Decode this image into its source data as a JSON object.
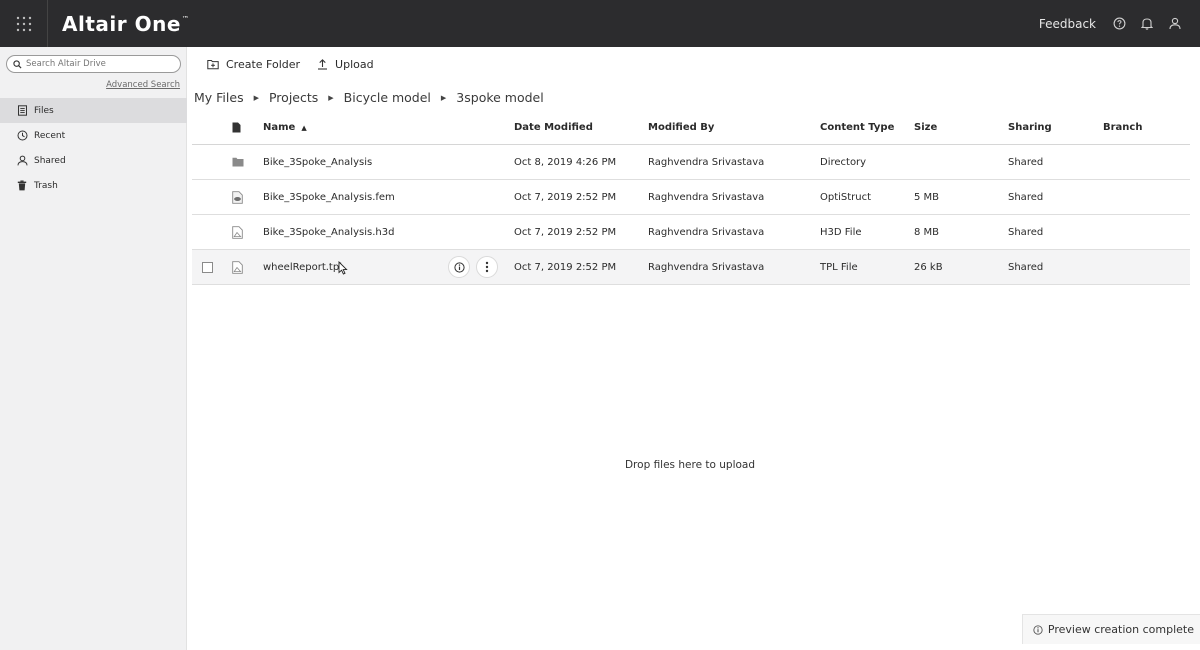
{
  "header": {
    "brand": "Altair One",
    "trademark": "™",
    "feedback_label": "Feedback",
    "icons": [
      "apps-grid-icon",
      "help-icon",
      "bell-icon",
      "user-icon"
    ]
  },
  "sidebar": {
    "search_placeholder": "Search Altair Drive",
    "advanced_search": "Advanced Search",
    "items": [
      {
        "label": "Files",
        "icon": "files-icon"
      },
      {
        "label": "Recent",
        "icon": "clock-icon"
      },
      {
        "label": "Shared",
        "icon": "person-icon"
      },
      {
        "label": "Trash",
        "icon": "trash-icon"
      }
    ],
    "active_item": "Files"
  },
  "toolbar": {
    "create_folder": "Create Folder",
    "upload": "Upload"
  },
  "breadcrumb": [
    "My Files",
    "Projects",
    "Bicycle model",
    "3spoke model"
  ],
  "table": {
    "columns": {
      "name": "Name",
      "date_modified": "Date Modified",
      "modified_by": "Modified By",
      "content_type": "Content Type",
      "size": "Size",
      "sharing": "Sharing",
      "branch": "Branch"
    },
    "rows": [
      {
        "icon": "folder-icon",
        "name": "Bike_3Spoke_Analysis",
        "date": "Oct 8, 2019 4:26 PM",
        "by": "Raghvendra Srivastava",
        "type": "Directory",
        "size": "",
        "sharing": "Shared",
        "branch": ""
      },
      {
        "icon": "fem-file-icon",
        "name": "Bike_3Spoke_Analysis.fem",
        "date": "Oct 7, 2019 2:52 PM",
        "by": "Raghvendra Srivastava",
        "type": "OptiStruct",
        "size": "5 MB",
        "sharing": "Shared",
        "branch": ""
      },
      {
        "icon": "generic-file-icon",
        "name": "Bike_3Spoke_Analysis.h3d",
        "date": "Oct 7, 2019 2:52 PM",
        "by": "Raghvendra Srivastava",
        "type": "H3D File",
        "size": "8 MB",
        "sharing": "Shared",
        "branch": ""
      },
      {
        "icon": "generic-file-icon",
        "name": "wheelReport.tpl",
        "date": "Oct 7, 2019 2:52 PM",
        "by": "Raghvendra Srivastava",
        "type": "TPL File",
        "size": "26 kB",
        "sharing": "Shared",
        "branch": ""
      }
    ]
  },
  "dropzone_text": "Drop files here to upload",
  "toast_text": "Preview creation complete",
  "colors": {
    "header_bg": "#2c2c2e",
    "sidebar_bg": "#f1f1f2",
    "active_item_bg": "#dcdcde"
  }
}
